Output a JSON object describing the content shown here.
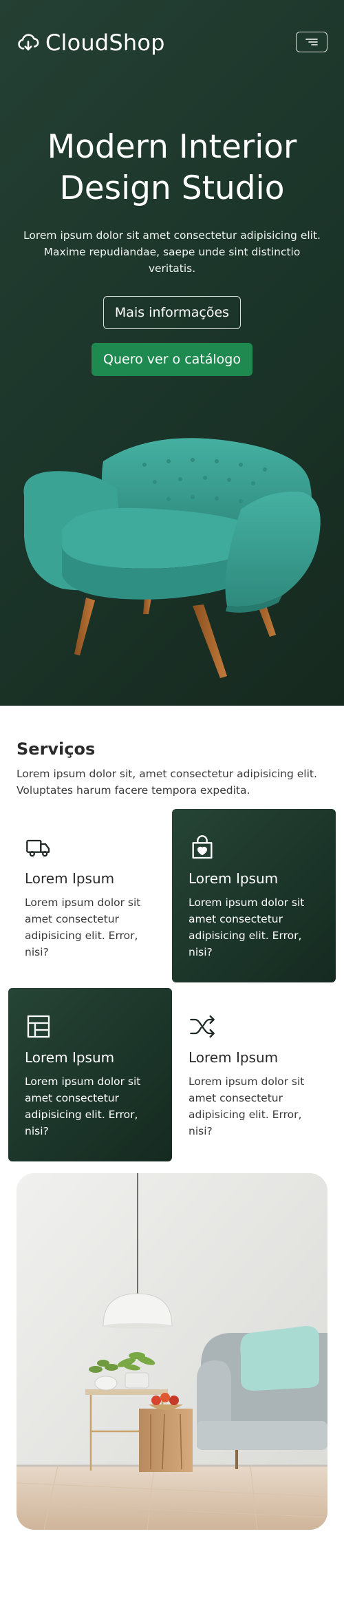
{
  "header": {
    "brand": "CloudShop",
    "brand_icon": "cloud-download-icon",
    "menu_icon": "menu-icon"
  },
  "hero": {
    "title_line1": "Modern Interior",
    "title_line2": "Design Studio",
    "subtitle": "Lorem ipsum dolor sit amet consectetur adipisicing elit. Maxime repudiandae, saepe unde sint distinctio veritatis.",
    "more_info_label": "Mais informações",
    "catalog_label": "Quero ver o catálogo",
    "image": "teal-armchair"
  },
  "services": {
    "title": "Serviços",
    "description": "Lorem ipsum dolor sit, amet consectetur adipisicing elit. Voluptates harum facere tempora expedita.",
    "cards": [
      {
        "icon": "truck-icon",
        "title": "Lorem Ipsum",
        "text": "Lorem ipsum dolor sit amet consectetur adipisicing elit. Error, nisi?",
        "style": "light"
      },
      {
        "icon": "shopping-bag-heart-icon",
        "title": "Lorem Ipsum",
        "text": "Lorem ipsum dolor sit amet consectetur adipisicing elit. Error, nisi?",
        "style": "dark"
      },
      {
        "icon": "layout-icon",
        "title": "Lorem Ipsum",
        "text": "Lorem ipsum dolor sit amet consectetur adipisicing elit. Error, nisi?",
        "style": "dark"
      },
      {
        "icon": "shuffle-icon",
        "title": "Lorem Ipsum",
        "text": "Lorem ipsum dolor sit amet consectetur adipisicing elit. Error, nisi?",
        "style": "light"
      }
    ]
  },
  "showcase": {
    "image": "living-room-interior"
  },
  "colors": {
    "hero_bg": "#1b3429",
    "accent": "#1f8a4f",
    "chair": "#3aa394",
    "text_dark": "#2b2b2b"
  }
}
